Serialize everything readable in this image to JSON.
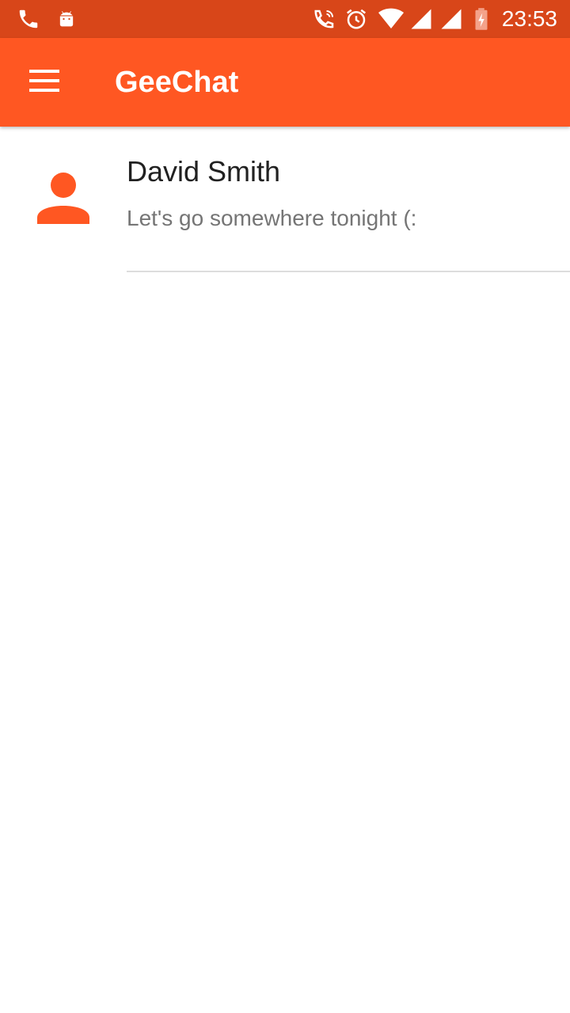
{
  "status_bar": {
    "time": "23:53",
    "left_icons": [
      "phone-icon",
      "android-icon"
    ],
    "right_icons": [
      "wifi-call-icon",
      "alarm-icon",
      "wifi-icon",
      "signal-icon",
      "signal-icon",
      "battery-charging-icon"
    ]
  },
  "app_bar": {
    "title": "GeeChat",
    "menu_icon": "menu-icon",
    "color": "#ff5722"
  },
  "chats": [
    {
      "name": "David Smith",
      "preview": "Let's go somewhere tonight (:",
      "avatar_icon": "person-icon"
    }
  ],
  "colors": {
    "primary": "#ff5722",
    "primary_dark": "#d84619",
    "text_primary": "#212121",
    "text_secondary": "#757575"
  }
}
